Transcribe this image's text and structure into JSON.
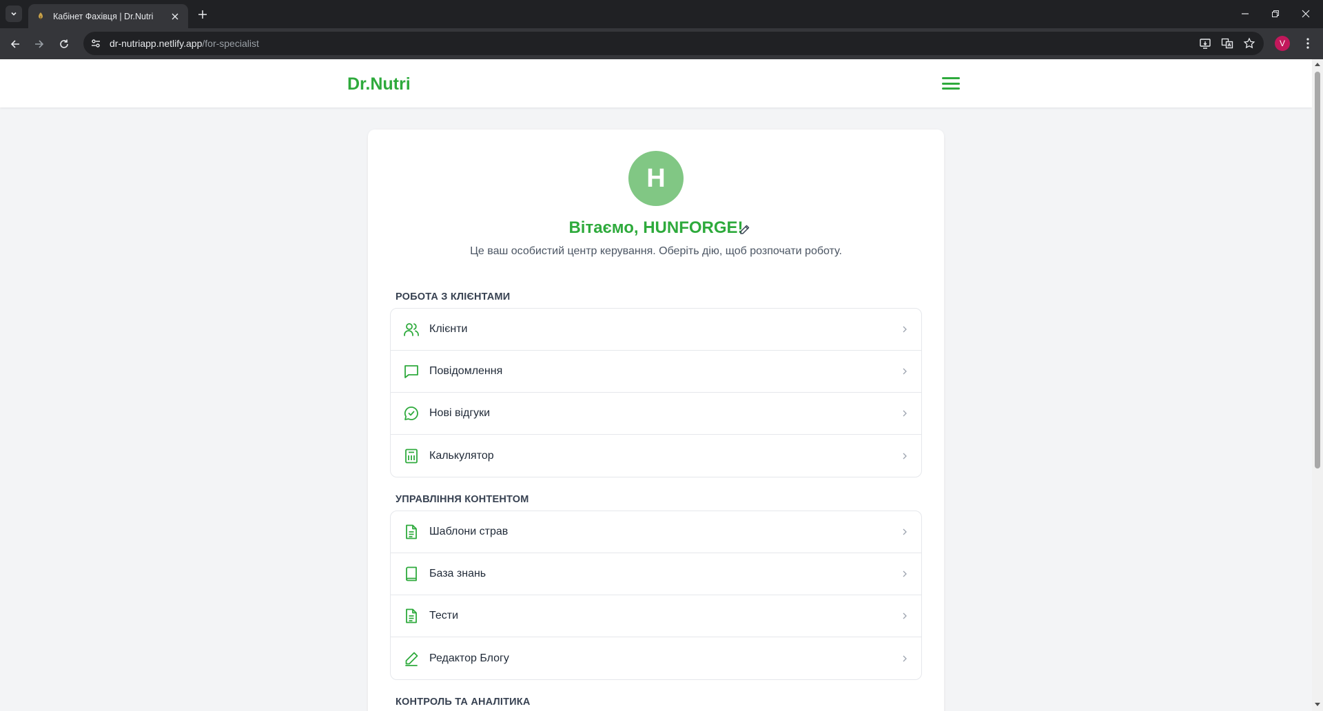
{
  "browser": {
    "tab_title": "Кабінет Фахівця | Dr.Nutri",
    "url_host": "dr-nutriapp.netlify.app",
    "url_path": "/for-specialist",
    "profile_initial": "V",
    "colors": {
      "frame": "#202124",
      "toolbar": "#35363a",
      "profile": "#c2185b"
    }
  },
  "header": {
    "logo": "Dr.Nutri",
    "menu_icon": "hamburger-icon"
  },
  "profile": {
    "avatar_letter": "H",
    "welcome": "Вітаємо, HUNFORGE!",
    "subtitle": "Це ваш особистий центр керування. Оберіть дію, щоб розпочати роботу."
  },
  "sections": [
    {
      "title": "РОБОТА З КЛІЄНТАМИ",
      "items": [
        {
          "label": "Клієнти",
          "icon": "users-icon"
        },
        {
          "label": "Повідомлення",
          "icon": "message-square-icon"
        },
        {
          "label": "Нові відгуки",
          "icon": "message-circle-icon"
        },
        {
          "label": "Калькулятор",
          "icon": "calculator-icon"
        }
      ]
    },
    {
      "title": "УПРАВЛІННЯ КОНТЕНТОМ",
      "items": [
        {
          "label": "Шаблони страв",
          "icon": "file-text-icon"
        },
        {
          "label": "База знань",
          "icon": "book-icon"
        },
        {
          "label": "Тести",
          "icon": "file-text-icon"
        },
        {
          "label": "Редактор Блогу",
          "icon": "pen-icon"
        }
      ]
    },
    {
      "title": "КОНТРОЛЬ ТА АНАЛІТИКА",
      "items": []
    }
  ],
  "colors": {
    "brand": "#2eaa3c",
    "avatar": "#81c784",
    "page_bg": "#f3f4f6"
  }
}
